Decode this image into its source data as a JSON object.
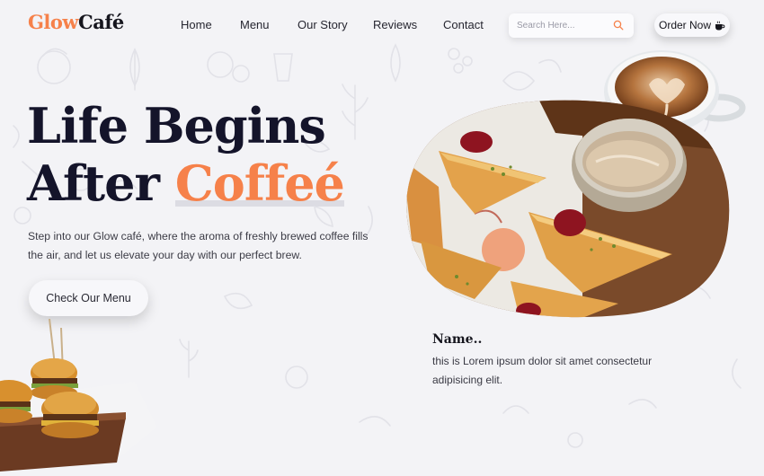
{
  "brand": {
    "part1": "Glow",
    "part2": "Café"
  },
  "nav": {
    "links": [
      "Home",
      "Menu",
      "Our Story",
      "Reviews",
      "Contact"
    ],
    "search_placeholder": "Search Here...",
    "order_label": "Order Now"
  },
  "hero": {
    "title_line1": "Life Begins",
    "title_line2_prefix": "After ",
    "title_line2_accent": "Coffeé",
    "description": "Step into our Glow café, where the aroma of freshly brewed coffee fills the air, and let us elevate your day with our perfect brew.",
    "cta_label": "Check Our Menu"
  },
  "feature_card": {
    "name": "Name..",
    "description": "this is Lorem ipsum dolor sit amet consectetur adipisicing elit."
  },
  "colors": {
    "accent": "#f6814a",
    "background": "#f3f3f6",
    "heading": "#14142a"
  },
  "icons": [
    "search-icon",
    "coffee-cup-icon"
  ]
}
